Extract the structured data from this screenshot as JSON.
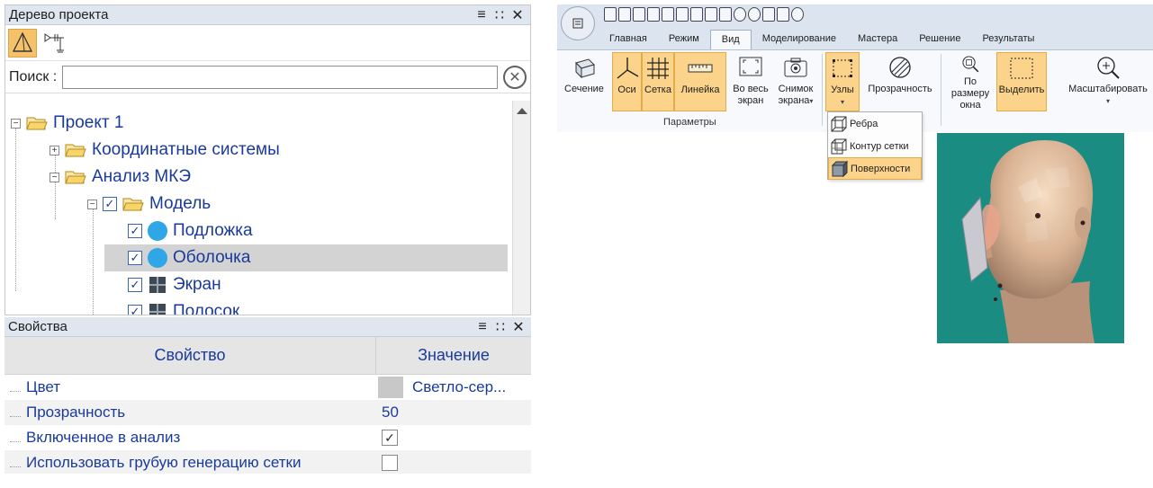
{
  "tree_panel": {
    "title": "Дерево проекта",
    "menu_icon": "≡",
    "pin_icon": "∷",
    "close_icon": "✕",
    "search_label": "Поиск :",
    "search_value": "",
    "items": [
      {
        "label": "Проект 1"
      },
      {
        "label": "Координатные системы"
      },
      {
        "label": "Анализ МКЭ"
      },
      {
        "label": "Модель",
        "checked": true
      },
      {
        "label": "Подложка",
        "checked": true
      },
      {
        "label": "Оболочка",
        "checked": true
      },
      {
        "label": "Экран",
        "checked": true
      },
      {
        "label": "Полосок",
        "checked": true
      }
    ]
  },
  "props_panel": {
    "title": "Свойства",
    "menu_icon": "≡",
    "pin_icon": "∷",
    "close_icon": "✕",
    "col_property": "Свойство",
    "col_value": "Значение",
    "rows": [
      {
        "name": "Цвет",
        "value": "Светло-сер..."
      },
      {
        "name": "Прозрачность",
        "value": "50"
      },
      {
        "name": "Включенное в анализ",
        "value": "✓"
      },
      {
        "name": "Использовать грубую генерацию сетки",
        "value": ""
      }
    ],
    "color_swatch": "#c8c8c8"
  },
  "ribbon": {
    "tabs": [
      "Главная",
      "Режим",
      "Вид",
      "Моделирование",
      "Мастера",
      "Решение",
      "Результаты"
    ],
    "active_tab": "Вид",
    "buttons": {
      "section": "Сечение",
      "axes": "Оси",
      "grid": "Сетка",
      "ruler": "Линейка",
      "fullscreen_1": "Во весь",
      "fullscreen_2": "экран",
      "snapshot_1": "Снимок",
      "snapshot_2": "экрана",
      "nodes": "Узлы",
      "transparency": "Прозрачность",
      "fit_1": "По размеру",
      "fit_2": "окна",
      "select": "Выделить",
      "zoom": "Масштабировать"
    },
    "group_params": "Параметры"
  },
  "dropdown": {
    "items": [
      "Ребра",
      "Контур сетки",
      "Поверхности"
    ]
  }
}
